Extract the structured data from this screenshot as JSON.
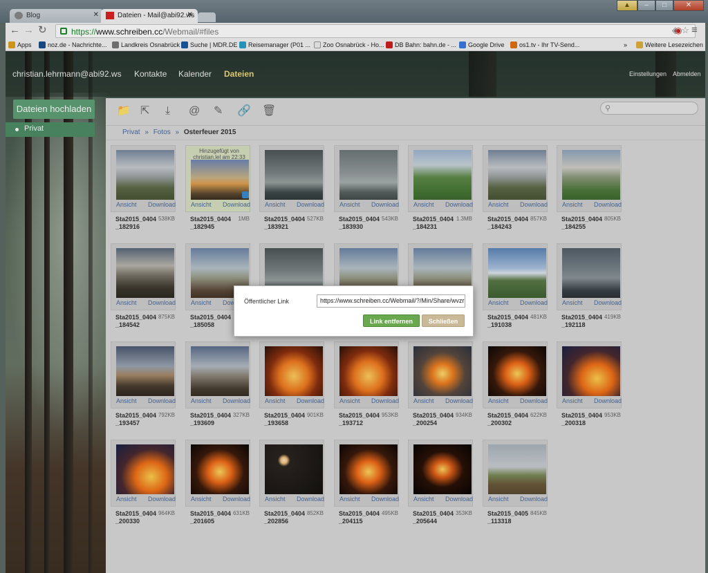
{
  "browser": {
    "tabs": [
      {
        "label": "Blog"
      },
      {
        "label": "Dateien - Mail@abi92.ws"
      }
    ],
    "url_https": "https://",
    "url_main": "www.schreiben.cc",
    "url_path": "/Webmail/#files",
    "bookmarks": [
      {
        "label": "Apps",
        "color": "#e0a020"
      },
      {
        "label": "noz.de - Nachrichte...",
        "color": "#1a4d8c"
      },
      {
        "label": "Landkreis Osnabrück",
        "color": "#777777"
      },
      {
        "label": "Suche | MDR.DE",
        "color": "#1a5aa0"
      },
      {
        "label": "Reisemanager (P01 ...",
        "color": "#2aa0c8"
      },
      {
        "label": "Zoo Osnabrück - Ho...",
        "color": "#eeeeee"
      },
      {
        "label": "DB Bahn: bahn.de - ...",
        "color": "#d02020"
      },
      {
        "label": "Google Drive",
        "color": "#3a7ae0"
      },
      {
        "label": "os1.tv - Ihr TV-Send...",
        "color": "#e07010"
      },
      {
        "label": "»",
        "color": ""
      },
      {
        "label": "Weitere Lesezeichen",
        "color": "#e0b040"
      }
    ]
  },
  "header": {
    "user": "christian.lehrmann@abi92.ws",
    "nav": [
      {
        "label": "Kontakte"
      },
      {
        "label": "Kalender"
      },
      {
        "label": "Dateien"
      }
    ],
    "settings": "Einstellungen",
    "logout": "Abmelden"
  },
  "sidebar": {
    "upload": "Dateien hochladen",
    "folder": "Privat"
  },
  "breadcrumb": {
    "items": [
      "Privat",
      "Fotos"
    ],
    "current": "Osterfeuer 2015",
    "sep": "»"
  },
  "file_actions": {
    "view": "Ansicht",
    "download": "Download"
  },
  "files": [
    {
      "name": "Sta2015_0404_182916",
      "size": "538KB",
      "scene": "day-smoke"
    },
    {
      "name": "Sta2015_0404_182945",
      "size": "1MB",
      "scene": "tree-sunset",
      "added": "Hinzugefügt von christian.lel am 22:33"
    },
    {
      "name": "Sta2015_0404_183921",
      "size": "527KB",
      "scene": "grey-sky"
    },
    {
      "name": "Sta2015_0404_183930",
      "size": "543KB",
      "scene": "grey-sky2"
    },
    {
      "name": "Sta2015_0404_184231",
      "size": "1.3MB",
      "scene": "field-green"
    },
    {
      "name": "Sta2015_0404_184243",
      "size": "857KB",
      "scene": "day-smoke"
    },
    {
      "name": "Sta2015_0404_184255",
      "size": "805KB",
      "scene": "field-smoke"
    },
    {
      "name": "Sta2015_0404_184542",
      "size": "875KB",
      "scene": "smoke-dark"
    },
    {
      "name": "Sta2015_0404_185058",
      "size": "",
      "scene": "village"
    },
    {
      "name": "",
      "size": "",
      "scene": "grey-sky"
    },
    {
      "name": "",
      "size": "",
      "scene": "village"
    },
    {
      "name": "",
      "size": "",
      "scene": "village"
    },
    {
      "name": "Sta2015_0404_191038",
      "size": "481KB",
      "scene": "mountain"
    },
    {
      "name": "Sta2015_0404_192118",
      "size": "419KB",
      "scene": "dusk-grey"
    },
    {
      "name": "Sta2015_0404_193457",
      "size": "792KB",
      "scene": "dusk-fire"
    },
    {
      "name": "Sta2015_0404_193609",
      "size": "327KB",
      "scene": "dusk-people"
    },
    {
      "name": "Sta2015_0404_193658",
      "size": "901KB",
      "scene": "fire-big"
    },
    {
      "name": "Sta2015_0404_193712",
      "size": "953KB",
      "scene": "fire-big"
    },
    {
      "name": "Sta2015_0404_200254",
      "size": "934KB",
      "scene": "fire-dusk"
    },
    {
      "name": "Sta2015_0404_200302",
      "size": "622KB",
      "scene": "fire-night"
    },
    {
      "name": "Sta2015_0404_200318",
      "size": "953KB",
      "scene": "fire-blue"
    },
    {
      "name": "Sta2015_0404_200330",
      "size": "964KB",
      "scene": "fire-blue"
    },
    {
      "name": "Sta2015_0404_201605",
      "size": "631KB",
      "scene": "fire-night"
    },
    {
      "name": "Sta2015_0404_202856",
      "size": "852KB",
      "scene": "moon"
    },
    {
      "name": "Sta2015_0404_204115",
      "size": "495KB",
      "scene": "fire-night"
    },
    {
      "name": "Sta2015_0404_205644",
      "size": "353KB",
      "scene": "fire-crowd"
    },
    {
      "name": "Sta2015_0405_113318",
      "size": "845KB",
      "scene": "trees-field"
    }
  ],
  "modal": {
    "label": "Öffentlicher Link",
    "link": "https://www.schreiben.cc/Webmail/?/Min/Share/wvzrl",
    "remove": "Link entfernen",
    "close": "Schließen"
  }
}
